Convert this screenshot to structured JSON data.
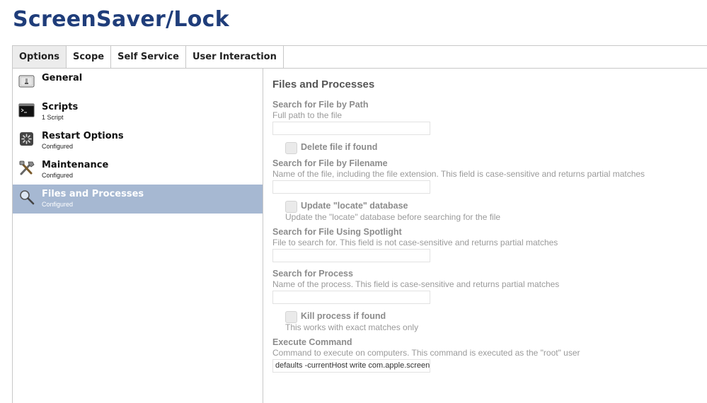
{
  "page": {
    "title": "ScreenSaver/Lock"
  },
  "tabs": [
    {
      "label": "Options",
      "active": true
    },
    {
      "label": "Scope"
    },
    {
      "label": "Self Service"
    },
    {
      "label": "User Interaction"
    }
  ],
  "sidebar": {
    "items": [
      {
        "label": "General",
        "sub": "",
        "icon": "general-icon"
      },
      {
        "label": "Scripts",
        "sub": "1 Script",
        "icon": "terminal-icon"
      },
      {
        "label": "Restart Options",
        "sub": "Configured",
        "icon": "restart-icon"
      },
      {
        "label": "Maintenance",
        "sub": "Configured",
        "icon": "tools-icon"
      },
      {
        "label": "Files and Processes",
        "sub": "Configured",
        "icon": "magnifier-icon",
        "active": true
      }
    ]
  },
  "main": {
    "title": "Files and Processes",
    "search_path": {
      "label": "Search for File by Path",
      "help": "Full path to the file",
      "value": ""
    },
    "delete_file": {
      "label": "Delete file if found",
      "checked": false
    },
    "search_filename": {
      "label": "Search for File by Filename",
      "help": "Name of the file, including the file extension. This field is case-sensitive and returns partial matches",
      "value": ""
    },
    "update_locate": {
      "label": "Update \"locate\" database",
      "help": "Update the \"locate\" database before searching for the file",
      "checked": false
    },
    "search_spotlight": {
      "label": "Search for File Using Spotlight",
      "help": "File to search for. This field is not case-sensitive and returns partial matches",
      "value": ""
    },
    "search_process": {
      "label": "Search for Process",
      "help": "Name of the process. This field is case-sensitive and returns partial matches",
      "value": ""
    },
    "kill_process": {
      "label": "Kill process if found",
      "help": "This works with exact matches only",
      "checked": false
    },
    "execute_command": {
      "label": "Execute Command",
      "help": "Command to execute on computers. This command is executed as the \"root\" user",
      "value": "defaults -currentHost write com.apple.screensaver"
    }
  }
}
